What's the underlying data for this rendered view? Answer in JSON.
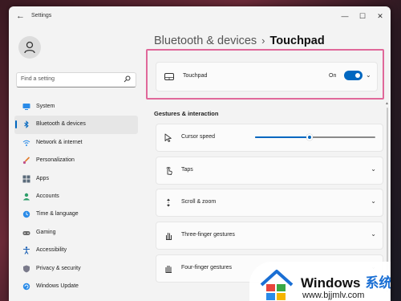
{
  "window": {
    "title": "Settings",
    "controls": {
      "minimize": "—",
      "maximize": "☐",
      "close": "✕"
    }
  },
  "sidebar": {
    "search_placeholder": "Find a setting",
    "items": [
      {
        "label": "System",
        "icon": "monitor-icon",
        "active": false
      },
      {
        "label": "Bluetooth & devices",
        "icon": "bluetooth-icon",
        "active": true
      },
      {
        "label": "Network & internet",
        "icon": "wifi-icon",
        "active": false
      },
      {
        "label": "Personalization",
        "icon": "paintbrush-icon",
        "active": false
      },
      {
        "label": "Apps",
        "icon": "apps-icon",
        "active": false
      },
      {
        "label": "Accounts",
        "icon": "person-icon",
        "active": false
      },
      {
        "label": "Time & language",
        "icon": "globe-clock-icon",
        "active": false
      },
      {
        "label": "Gaming",
        "icon": "gamepad-icon",
        "active": false
      },
      {
        "label": "Accessibility",
        "icon": "accessibility-icon",
        "active": false
      },
      {
        "label": "Privacy & security",
        "icon": "shield-icon",
        "active": false
      },
      {
        "label": "Windows Update",
        "icon": "update-icon",
        "active": false
      }
    ]
  },
  "header": {
    "parent": "Bluetooth & devices",
    "separator": "›",
    "current": "Touchpad"
  },
  "touchpad": {
    "label": "Touchpad",
    "state_label": "On",
    "enabled": true
  },
  "gestures": {
    "section_title": "Gestures & interaction",
    "cursor_speed": {
      "label": "Cursor speed",
      "level": 0.45
    },
    "rows": [
      {
        "label": "Taps",
        "icon": "tap-hand-icon"
      },
      {
        "label": "Scroll & zoom",
        "icon": "scroll-icon"
      },
      {
        "label": "Three-finger gestures",
        "icon": "three-finger-hand-icon"
      },
      {
        "label": "Four-finger gestures",
        "icon": "four-finger-hand-icon"
      }
    ]
  },
  "watermark": {
    "brand": "Windows",
    "brand_cn": "系统之家",
    "url": "www.bjjmlv.com"
  },
  "colors": {
    "accent": "#0067c0",
    "highlight_border": "#e0689a"
  }
}
